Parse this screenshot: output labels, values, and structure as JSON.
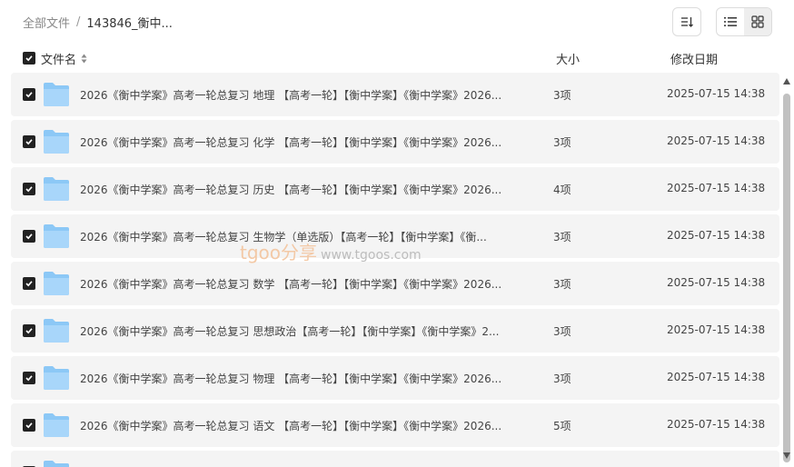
{
  "breadcrumb": {
    "root": "全部文件",
    "separator": "/",
    "current": "143846_衡中..."
  },
  "columns": {
    "name": "文件名",
    "size": "大小",
    "date": "修改日期"
  },
  "files": [
    {
      "name": "2026《衡中学案》高考一轮总复习 地理 【高考一轮】【衡中学案】《衡中学案》2026...",
      "size": "3项",
      "date": "2025-07-15 14:38"
    },
    {
      "name": "2026《衡中学案》高考一轮总复习 化学 【高考一轮】【衡中学案】《衡中学案》2026...",
      "size": "3项",
      "date": "2025-07-15 14:38"
    },
    {
      "name": "2026《衡中学案》高考一轮总复习 历史 【高考一轮】【衡中学案】《衡中学案》2026...",
      "size": "4项",
      "date": "2025-07-15 14:38"
    },
    {
      "name": "2026《衡中学案》高考一轮总复习 生物学（单选版）【高考一轮】【衡中学案】《衡...",
      "size": "3项",
      "date": "2025-07-15 14:38"
    },
    {
      "name": "2026《衡中学案》高考一轮总复习 数学 【高考一轮】【衡中学案】《衡中学案》2026...",
      "size": "3项",
      "date": "2025-07-15 14:38"
    },
    {
      "name": "2026《衡中学案》高考一轮总复习 思想政治【高考一轮】【衡中学案】《衡中学案》2...",
      "size": "3项",
      "date": "2025-07-15 14:38"
    },
    {
      "name": "2026《衡中学案》高考一轮总复习 物理 【高考一轮】【衡中学案】《衡中学案》2026...",
      "size": "3项",
      "date": "2025-07-15 14:38"
    },
    {
      "name": "2026《衡中学案》高考一轮总复习 语文 【高考一轮】【衡中学案】《衡中学案》2026...",
      "size": "5项",
      "date": "2025-07-15 14:38"
    }
  ],
  "watermark": {
    "brand": "tgoo分享",
    "url": "www.tgoos.com"
  },
  "colors": {
    "folder": "#8cc8f6",
    "checkbox": "#222222",
    "row_bg": "#f4f4f4"
  }
}
